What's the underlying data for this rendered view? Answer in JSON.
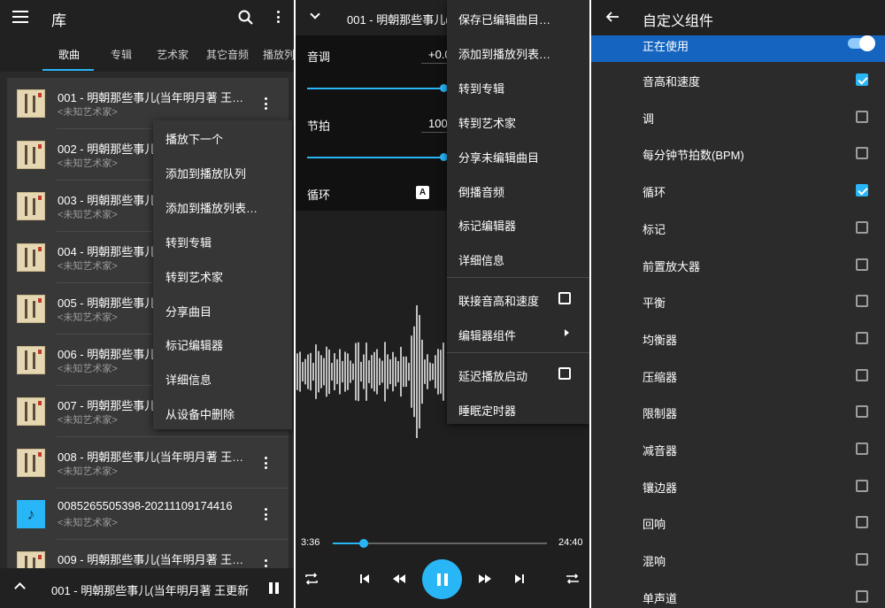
{
  "colors": {
    "accent": "#29b6f6",
    "selected_row": "#1565c0"
  },
  "left": {
    "title": "库",
    "tabs": [
      "歌曲",
      "专辑",
      "艺术家",
      "其它音频",
      "播放列"
    ],
    "rows": [
      {
        "title": "001 - 明朝那些事儿(当年明月著 王…",
        "artist": "<未知艺术家>",
        "art": "book"
      },
      {
        "title": "002 - 明朝那些事儿",
        "artist": "<未知艺术家>",
        "art": "book"
      },
      {
        "title": "003 - 明朝那些事儿",
        "artist": "<未知艺术家>",
        "art": "book"
      },
      {
        "title": "004 - 明朝那些事儿",
        "artist": "<未知艺术家>",
        "art": "book"
      },
      {
        "title": "005 - 明朝那些事儿",
        "artist": "<未知艺术家>",
        "art": "book"
      },
      {
        "title": "006 - 明朝那些事儿",
        "artist": "<未知艺术家>",
        "art": "book"
      },
      {
        "title": "007 - 明朝那些事儿",
        "artist": "<未知艺术家>",
        "art": "book"
      },
      {
        "title": "008 - 明朝那些事儿(当年明月著 王…",
        "artist": "<未知艺术家>",
        "art": "book"
      },
      {
        "title": "0085265505398-20211109174416",
        "artist": "<未知艺术家>",
        "art": "note"
      },
      {
        "title": "009 - 明朝那些事儿(当年明月著 王…",
        "artist": "<未知艺术家>",
        "art": "book"
      }
    ],
    "menu": [
      "播放下一个",
      "添加到播放队列",
      "添加到播放列表…",
      "转到专辑",
      "转到艺术家",
      "分享曲目",
      "标记编辑器",
      "详细信息",
      "从设备中删除"
    ],
    "mini_player": {
      "title": "001 - 明朝那些事儿(当年明月著 王更新"
    }
  },
  "middle": {
    "title": "001 - 明朝那些事儿(",
    "pitch_label": "音调",
    "pitch_value": "+0.0",
    "tempo_label": "节拍",
    "tempo_value": "100",
    "loop_label": "循环",
    "loop_badge": "A",
    "menu": [
      "保存已编辑曲目…",
      "添加到播放列表…",
      "转到专辑",
      "转到艺术家",
      "分享未编辑曲目",
      "倒播音频",
      "标记编辑器",
      "详细信息"
    ],
    "menu_link": "联接音高和速度",
    "menu_components": "编辑器组件",
    "menu_delay": "延迟播放启动",
    "menu_sleep": "睡眠定时器",
    "elapsed": "3:36",
    "duration": "24:40",
    "progress": 0.146
  },
  "right": {
    "title": "自定义组件",
    "in_use": "正在使用",
    "options": [
      {
        "label": "音高和速度",
        "checked": true
      },
      {
        "label": "调",
        "checked": false
      },
      {
        "label": "每分钟节拍数(BPM)",
        "checked": false
      },
      {
        "label": "循环",
        "checked": true
      },
      {
        "label": "标记",
        "checked": false
      },
      {
        "label": "前置放大器",
        "checked": false
      },
      {
        "label": "平衡",
        "checked": false
      },
      {
        "label": "均衡器",
        "checked": false
      },
      {
        "label": "压缩器",
        "checked": false
      },
      {
        "label": "限制器",
        "checked": false
      },
      {
        "label": "减音器",
        "checked": false
      },
      {
        "label": "镶边器",
        "checked": false
      },
      {
        "label": "回响",
        "checked": false
      },
      {
        "label": "混响",
        "checked": false
      },
      {
        "label": "单声道",
        "checked": false
      }
    ]
  }
}
